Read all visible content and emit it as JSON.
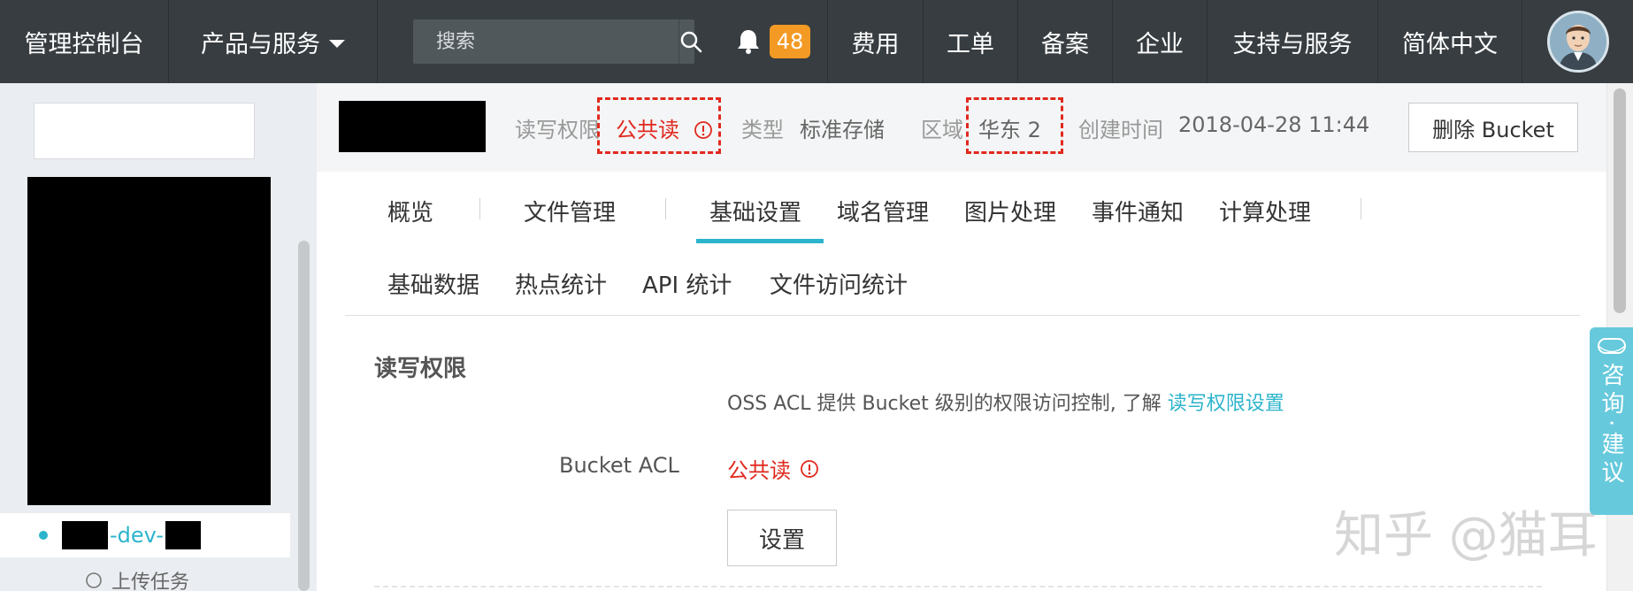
{
  "topbar": {
    "console": "管理控制台",
    "products": "产品与服务",
    "search_placeholder": "搜索",
    "notification_count": "48",
    "nav": [
      "费用",
      "工单",
      "备案",
      "企业",
      "支持与服务",
      "简体中文"
    ]
  },
  "sidebar": {
    "bucket_item_mid": "-dev-",
    "upload_label": "上传任务"
  },
  "infobar": {
    "acl_label": "读写权限",
    "acl_value": "公共读",
    "type_label": "类型",
    "type_value": "标准存储",
    "region_label": "区域",
    "region_value": "华东 2",
    "created_label": "创建时间",
    "created_value": "2018-04-28 11:44",
    "delete_button": "删除 Bucket"
  },
  "tabs": {
    "row1": [
      "概览",
      "文件管理",
      "基础设置",
      "域名管理",
      "图片处理",
      "事件通知",
      "计算处理"
    ],
    "row2": [
      "基础数据",
      "热点统计",
      "API 统计",
      "文件访问统计"
    ],
    "active": "基础设置"
  },
  "acl_section": {
    "title": "读写权限",
    "description": "OSS ACL 提供 Bucket 级别的权限访问控制, 了解 ",
    "link": "读写权限设置",
    "label": "Bucket ACL",
    "value": "公共读",
    "set_button": "设置"
  },
  "consult_widget": "咨询·建议",
  "watermark": "知乎 @猫耳",
  "colors": {
    "topbar_bg": "#373d41",
    "accent": "#2cb4cc",
    "danger": "#e0291e",
    "badge": "#f39a24"
  }
}
